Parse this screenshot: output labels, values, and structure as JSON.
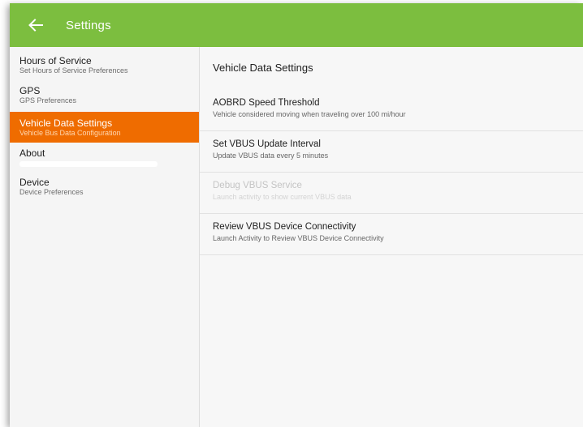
{
  "appbar": {
    "title": "Settings",
    "back_icon": "arrow-left-icon",
    "color": "#7cbe3f"
  },
  "sidebar": {
    "active_color": "#ef6c00",
    "items": [
      {
        "title": "Hours of Service",
        "subtitle": "Set Hours of Service Preferences",
        "active": false
      },
      {
        "title": "GPS",
        "subtitle": "GPS Preferences",
        "active": false
      },
      {
        "title": "Vehicle Data Settings",
        "subtitle": "Vehicle Bus Data Configuration",
        "active": true
      },
      {
        "title": "About",
        "subtitle": "",
        "active": false
      },
      {
        "title": "Device",
        "subtitle": "Device Preferences",
        "active": false
      }
    ]
  },
  "content": {
    "header": "Vehicle Data Settings",
    "prefs": [
      {
        "title": "AOBRD Speed Threshold",
        "subtitle": "Vehicle considered moving when traveling over 100 mi/hour",
        "enabled": true
      },
      {
        "title": "Set VBUS Update Interval",
        "subtitle": "Update VBUS data every 5 minutes",
        "enabled": true
      },
      {
        "title": "Debug VBUS Service",
        "subtitle": "Launch activity to show current VBUS data",
        "enabled": false
      },
      {
        "title": "Review VBUS Device Connectivity",
        "subtitle": "Launch Activity to Review VBUS Device Connectivity",
        "enabled": true
      }
    ]
  }
}
